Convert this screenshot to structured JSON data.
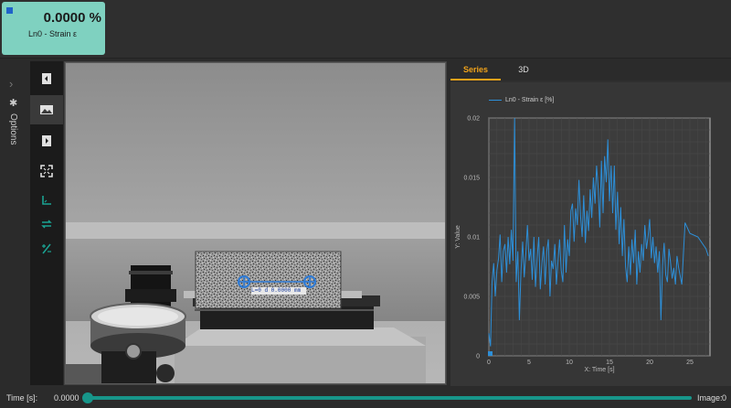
{
  "measurement": {
    "value": "0.0000 %",
    "label": "Ln0 - Strain ε",
    "card_color": "#7fd1c0",
    "marker_color": "#1f63c9"
  },
  "options": {
    "label": "Options",
    "chevron_icon": "chevron-right-icon",
    "gear_icon": "gear-icon"
  },
  "toolbar": {
    "tools": [
      {
        "icon": "panel-left-icon",
        "active": false
      },
      {
        "icon": "image-icon",
        "active": true
      },
      {
        "icon": "panel-right-icon",
        "active": false
      },
      {
        "icon": "fullscreen-icon",
        "active": false
      },
      {
        "icon": "axis-icon",
        "active": false
      },
      {
        "icon": "swap-icon",
        "active": false
      },
      {
        "icon": "percent-icon",
        "active": false
      }
    ]
  },
  "viewer": {
    "overlay_text": "L=0  d  0.0000 mm"
  },
  "tabs": [
    {
      "label": "Series",
      "active": true
    },
    {
      "label": "3D",
      "active": false
    }
  ],
  "accent_color": "#f0a21a",
  "series_color": "#2d8fd8",
  "chart_data": {
    "type": "line",
    "xlabel": "X: Time [s]",
    "ylabel": "Y: Value",
    "xlim": [
      0,
      27.5
    ],
    "ylim": [
      0,
      0.02
    ],
    "xticks": [
      0,
      5,
      10,
      15,
      20,
      25
    ],
    "yticks": [
      0,
      0.005,
      0.01,
      0.015,
      0.02
    ],
    "ytick_labels": [
      "0",
      "0.005",
      "0.01",
      "0.015",
      "0.02"
    ],
    "grid": true,
    "legend": "top-left",
    "series": [
      {
        "name": "Ln0 - Strain ε [%]",
        "x": [
          0,
          0.2,
          0.4,
          0.6,
          0.8,
          1.0,
          1.2,
          1.4,
          1.6,
          1.8,
          2.0,
          2.2,
          2.4,
          2.6,
          2.8,
          3.0,
          3.2,
          3.4,
          3.6,
          3.8,
          4.0,
          4.2,
          4.4,
          4.6,
          4.8,
          5.0,
          5.2,
          5.4,
          5.6,
          5.8,
          6.0,
          6.2,
          6.4,
          6.6,
          6.8,
          7.0,
          7.2,
          7.4,
          7.6,
          7.8,
          8.0,
          8.2,
          8.4,
          8.6,
          8.8,
          9.0,
          9.2,
          9.4,
          9.6,
          9.8,
          10.0,
          10.2,
          10.4,
          10.6,
          10.8,
          11.0,
          11.2,
          11.4,
          11.6,
          11.8,
          12.0,
          12.2,
          12.4,
          12.6,
          12.8,
          13.0,
          13.2,
          13.4,
          13.6,
          13.8,
          14.0,
          14.2,
          14.4,
          14.6,
          14.8,
          15.0,
          15.2,
          15.4,
          15.6,
          15.8,
          16.0,
          16.2,
          16.4,
          16.6,
          16.8,
          17.0,
          17.2,
          17.4,
          17.6,
          17.8,
          18.0,
          18.2,
          18.4,
          18.6,
          18.8,
          19.0,
          19.2,
          19.4,
          19.6,
          19.8,
          20.0,
          20.2,
          20.4,
          20.6,
          20.8,
          21.0,
          21.2,
          21.4,
          21.6,
          21.8,
          22.0,
          22.2,
          22.4,
          22.6,
          22.8,
          23.0,
          23.2,
          23.4,
          23.6,
          24.0,
          24.4,
          25.0,
          26.0,
          27.0,
          27.3
        ],
        "y": [
          0.0019,
          0.0008,
          0.0062,
          0.0078,
          0.005,
          0.0072,
          0.0082,
          0.0102,
          0.0062,
          0.0088,
          0.0094,
          0.007,
          0.01,
          0.0077,
          0.0106,
          0.008,
          0.02,
          0.0062,
          0.0088,
          0.003,
          0.0072,
          0.0096,
          0.0066,
          0.0086,
          0.011,
          0.008,
          0.009,
          0.0064,
          0.01,
          0.0058,
          0.0082,
          0.01,
          0.0056,
          0.0078,
          0.0092,
          0.006,
          0.0088,
          0.0098,
          0.005,
          0.008,
          0.0073,
          0.0094,
          0.006,
          0.008,
          0.0098,
          0.0072,
          0.0062,
          0.011,
          0.007,
          0.0098,
          0.0084,
          0.0122,
          0.0128,
          0.0096,
          0.0124,
          0.011,
          0.0148,
          0.0118,
          0.01,
          0.0135,
          0.0095,
          0.0122,
          0.0105,
          0.014,
          0.0116,
          0.015,
          0.0128,
          0.016,
          0.014,
          0.0108,
          0.0164,
          0.012,
          0.0168,
          0.0146,
          0.0182,
          0.013,
          0.016,
          0.012,
          0.016,
          0.0106,
          0.0138,
          0.0094,
          0.0125,
          0.0084,
          0.0115,
          0.0075,
          0.0062,
          0.0092,
          0.0068,
          0.0098,
          0.0078,
          0.0106,
          0.006,
          0.0088,
          0.007,
          0.0094,
          0.008,
          0.011,
          0.009,
          0.01,
          0.0115,
          0.0082,
          0.01,
          0.0078,
          0.0092,
          0.007,
          0.0088,
          0.003,
          0.0076,
          0.0095,
          0.0068,
          0.0062,
          0.009,
          0.0078,
          0.0065,
          0.0074,
          0.006,
          0.0084,
          0.0074,
          0.006,
          0.0112,
          0.0103,
          0.01,
          0.009,
          0.0084
        ]
      }
    ]
  },
  "bottombar": {
    "time_label": "Time [s]:",
    "time_value": "0.0000",
    "image_label": "Image:",
    "image_value": "0",
    "slider_color": "#17968a"
  }
}
